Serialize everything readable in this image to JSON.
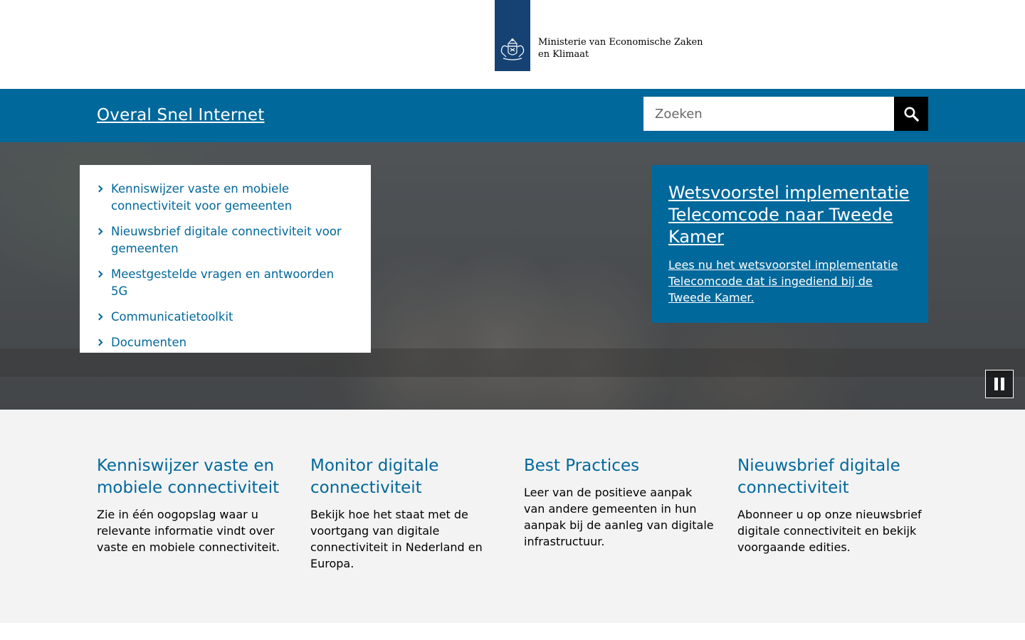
{
  "header": {
    "ministry_line1": "Ministerie van Economische Zaken",
    "ministry_line2": "en Klimaat"
  },
  "site": {
    "title": "Overal Snel Internet"
  },
  "search": {
    "placeholder": "Zoeken",
    "button_icon": "search-icon"
  },
  "hero": {
    "quicklinks": [
      {
        "label": "Kenniswijzer vaste en mobiele connectiviteit voor gemeenten"
      },
      {
        "label": "Nieuwsbrief digitale connectiviteit voor gemeenten"
      },
      {
        "label": "Meestgestelde vragen en antwoorden 5G"
      },
      {
        "label": "Communicatietoolkit"
      },
      {
        "label": "Documenten"
      }
    ],
    "featured": {
      "title": "Wetsvoorstel implementatie Telecomcode naar Tweede Kamer",
      "text": "Lees nu het wetsvoorstel implementatie Telecomcode dat is ingediend bij de Tweede Kamer."
    },
    "pause_icon": "pause-icon"
  },
  "cards": [
    {
      "title": "Kenniswijzer vaste en mobiele connectiviteit",
      "text": "Zie in één oogopslag waar u relevante informatie vindt over vaste en mobiele connectiviteit."
    },
    {
      "title": "Monitor digitale connectiviteit",
      "text": "Bekijk hoe het staat met de voortgang van digitale connectiviteit in Nederland en Europa."
    },
    {
      "title": "Best Practices",
      "text": "Leer van de positieve aanpak van andere gemeenten in hun aanpak bij de aanleg van digitale infrastructuur."
    },
    {
      "title": "Nieuwsbrief digitale connectiviteit",
      "text": "Abonneer u op onze nieuwsbrief digitale connectiviteit en bekijk voorgaande edities."
    }
  ],
  "colors": {
    "brand_blue": "#01689b",
    "logo_blue": "#154273",
    "card_bg": "#f3f3f3"
  }
}
